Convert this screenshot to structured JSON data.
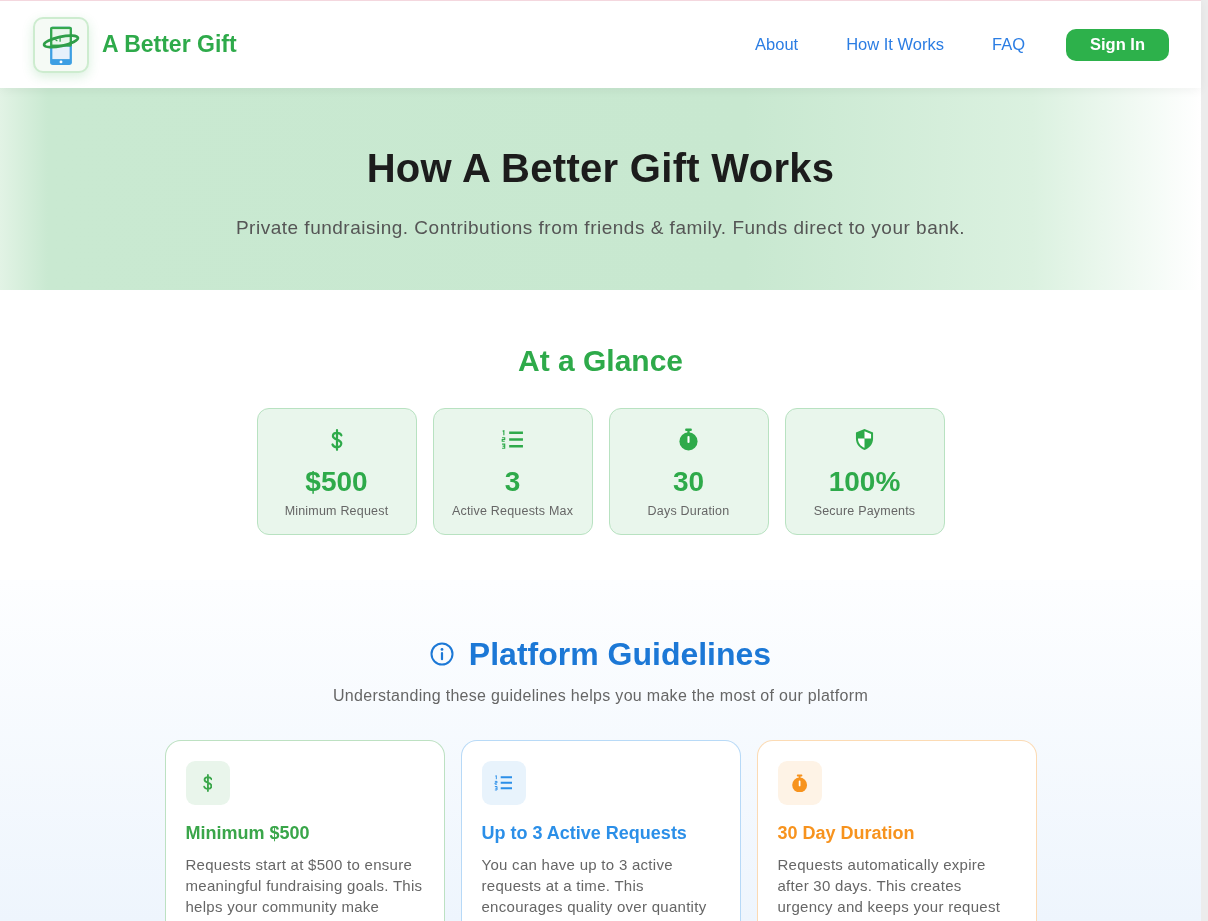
{
  "header": {
    "brand": "A Better Gift",
    "nav": [
      {
        "label": "About"
      },
      {
        "label": "How It Works"
      },
      {
        "label": "FAQ"
      }
    ],
    "sign_in": "Sign In"
  },
  "hero": {
    "title": "How A Better Gift Works",
    "subtitle": "Private fundraising. Contributions from friends & family. Funds direct to your bank."
  },
  "glance": {
    "title": "At a Glance",
    "stats": [
      {
        "kind": "dollar",
        "value": "$500",
        "label": "Minimum Request"
      },
      {
        "kind": "list",
        "value": "3",
        "label": "Active Requests Max"
      },
      {
        "kind": "timer",
        "value": "30",
        "label": "Days Duration"
      },
      {
        "kind": "shield",
        "value": "100%",
        "label": "Secure Payments"
      }
    ]
  },
  "guidelines": {
    "title": "Platform Guidelines",
    "subtitle": "Understanding these guidelines helps you make the most of our platform",
    "cards": [
      {
        "kind": "dollar",
        "color": "#3aa64a",
        "title": "Minimum $500",
        "body": "Requests start at $500 to ensure meaningful fundraising goals. This helps your community make"
      },
      {
        "kind": "list",
        "color": "#2b8fe8",
        "title": "Up to 3 Active Requests",
        "body": "You can have up to 3 active requests at a time. This encourages quality over quantity"
      },
      {
        "kind": "timer",
        "color": "#f7931e",
        "title": "30 Day Duration",
        "body": "Requests automatically expire after 30 days. This creates urgency and keeps your request"
      }
    ]
  }
}
